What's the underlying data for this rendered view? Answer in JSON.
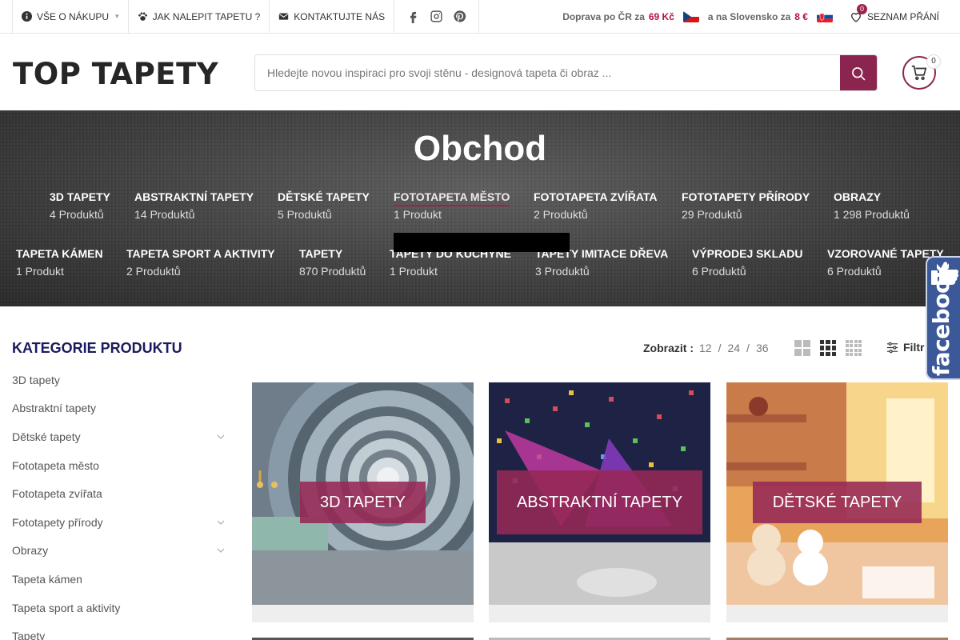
{
  "topbar": {
    "links": [
      {
        "label": "Vše o nákupu",
        "icon": "info-icon"
      },
      {
        "label": "Jak nalepit tapetu ?",
        "icon": "paw-icon"
      },
      {
        "label": "Kontaktujte nás",
        "icon": "envelope-icon"
      }
    ],
    "social": [
      "facebook-icon",
      "instagram-icon",
      "pinterest-icon"
    ],
    "shipping_cz_text": "Doprava po ČR za",
    "shipping_cz_price": "69 Kč",
    "shipping_sk_text": "a na Slovensko za",
    "shipping_sk_price": "8 €",
    "wishlist_label": "Seznam přání",
    "wishlist_count": "0"
  },
  "header": {
    "logo": "TOP TAPETY",
    "search_placeholder": "Hledejte novou inspiraci pro svoji stěnu - designová tapeta či obraz ...",
    "cart_count": "0"
  },
  "hero": {
    "title": "Obchod",
    "categories": [
      {
        "name": "3D tapety",
        "count": "4 Produktů"
      },
      {
        "name": "Abstraktní tapety",
        "count": "14 Produktů"
      },
      {
        "name": "Dětské tapety",
        "count": "5 Produktů"
      },
      {
        "name": "Fototapeta město",
        "count": "1 Produkt",
        "active": true
      },
      {
        "name": "Fototapeta zvířata",
        "count": "2 Produktů"
      },
      {
        "name": "Fototapety přírody",
        "count": "29 Produktů"
      },
      {
        "name": "Obrazy",
        "count": "1 298 Produktů"
      },
      {
        "name": "Tapeta kámen",
        "count": "1 Produkt"
      },
      {
        "name": "Tapeta sport a aktivity",
        "count": "2 Produktů"
      },
      {
        "name": "Tapety",
        "count": "870 Produktů"
      },
      {
        "name": "Tapety do kuchyně",
        "count": "1 Produkt"
      },
      {
        "name": "Tapety imitace dřeva",
        "count": "3 Produktů"
      },
      {
        "name": "Výprodej skladu",
        "count": "6 Produktů"
      },
      {
        "name": "Vzorované tapety",
        "count": "6 Produktů"
      }
    ]
  },
  "sidebar": {
    "title": "Kategorie produktu",
    "items": [
      {
        "label": "3D tapety",
        "expandable": false
      },
      {
        "label": "Abstraktní tapety",
        "expandable": false
      },
      {
        "label": "Dětské tapety",
        "expandable": true
      },
      {
        "label": "Fototapeta město",
        "expandable": false
      },
      {
        "label": "Fototapeta zvířata",
        "expandable": false
      },
      {
        "label": "Fototapety přírody",
        "expandable": true
      },
      {
        "label": "Obrazy",
        "expandable": true
      },
      {
        "label": "Tapeta kámen",
        "expandable": false
      },
      {
        "label": "Tapeta sport a aktivity",
        "expandable": false
      },
      {
        "label": "Tapety",
        "expandable": false
      }
    ]
  },
  "toolbar": {
    "show_label": "Zobrazit :",
    "per_page": [
      "12",
      "24",
      "36"
    ],
    "filter_label": "Filtr"
  },
  "facebook_widget": {
    "label": "facebook"
  },
  "products": [
    {
      "label": "3D tapety"
    },
    {
      "label": "Abstraktní tapety"
    },
    {
      "label": "Dětské tapety"
    }
  ],
  "colors": {
    "accent": "#8b2550",
    "price": "#b5103f",
    "sidebar_title": "#1a1a5e",
    "facebook": "#3b5998"
  }
}
